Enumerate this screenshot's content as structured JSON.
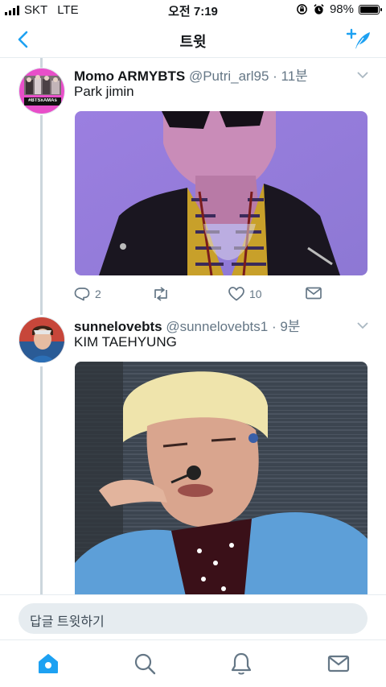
{
  "status_bar": {
    "carrier": "SKT",
    "network": "LTE",
    "time": "오전 7:19",
    "battery": "98%",
    "battery_level": 0.98
  },
  "nav": {
    "title": "트윗",
    "back_icon": "chevron-left-icon",
    "compose_icon": "compose-tweet-icon",
    "accent": "#1da1f2"
  },
  "tweets": [
    {
      "name": "Momo ARMYBTS",
      "handle": "@Putri_arl95",
      "time": "· 11분",
      "text": "Park jimin",
      "avatar_badge": "#BTSxAMAs",
      "replies": "2",
      "retweets": "",
      "likes": "10"
    },
    {
      "name": "sunnelovebts",
      "handle": "@sunnelovebts1",
      "time": "· 9분",
      "text": "KIM TAEHYUNG"
    }
  ],
  "reply_bar": {
    "placeholder": "답글 트윗하기"
  },
  "tabs": [
    "home-icon",
    "search-icon",
    "notifications-icon",
    "messages-icon"
  ]
}
